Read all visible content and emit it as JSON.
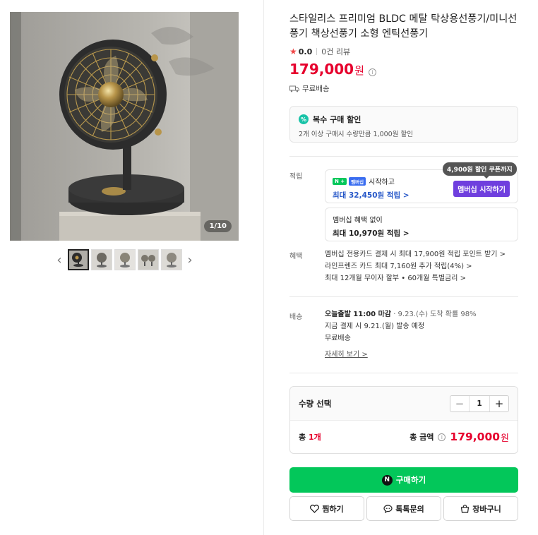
{
  "gallery": {
    "counter": "1/10"
  },
  "product": {
    "title": "스타일리스 프리미엄 BLDC 메탈 탁상용선풍기/미니선풍기 책상선풍기 소형 엔틱선풍기",
    "rating": "0.0",
    "reviews": "0건 리뷰",
    "price": "179,000",
    "price_unit": "원",
    "shipping_fee": "무료배송"
  },
  "discount": {
    "title": "복수 구매 할인",
    "desc": "2개 이상 구매시 수량만큼 1,000원 할인",
    "icon_text": "%"
  },
  "points": {
    "label": "적립",
    "n_badge": "N +",
    "member_badge": "멤버십",
    "start_text": "시작하고",
    "max_with": "최대 32,450원 적립 >",
    "member_button": "멤버십 시작하기",
    "coupon_tip": "4,900원 할인 쿠폰까지",
    "without_title": "멤버십 혜택 없이",
    "max_without": "최대 10,970원 적립 >"
  },
  "benefits": {
    "label": "혜택",
    "items": [
      "멤버십 전용카드 결제 시 최대 17,900원 적립 포인트 받기 >",
      "라인프렌즈 카드 최대 7,160원 추가 적립(4%) >",
      "최대 12개월 무이자 할부 • 60개월 특별금리 >"
    ]
  },
  "delivery": {
    "label": "배송",
    "today": "오늘출발 11:00 마감",
    "arrival": "· 9.23.(수) 도착 확률 98%",
    "dispatch": "지금 결제 시 9.21.(월) 발송 예정",
    "fee": "무료배송",
    "detail_link": "자세히 보기 >"
  },
  "quantity": {
    "label": "수량 선택",
    "value": "1",
    "minus": "−",
    "plus": "+",
    "total_prefix": "총 ",
    "total_count": "1개",
    "total_label": "총 금액",
    "total_price": "179,000",
    "total_unit": "원"
  },
  "actions": {
    "buy": "구매하기",
    "buy_icon": "N",
    "wish": "찜하기",
    "talk": "톡톡문의",
    "cart": "장바구니"
  },
  "colors": {
    "price_red": "#e6002d",
    "naver_green": "#03c75a",
    "member_purple": "#6f3fde"
  }
}
